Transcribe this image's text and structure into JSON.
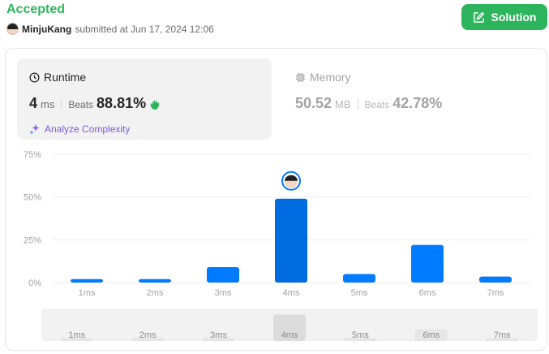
{
  "status": "Accepted",
  "submission": {
    "username": "MinjuKang",
    "submitted_text": "submitted at Jun 17, 2024 12:06"
  },
  "solution_button": {
    "label": "Solution",
    "color": "#2db55d"
  },
  "runtime": {
    "title": "Runtime",
    "value": "4",
    "unit": "ms",
    "beats_label": "Beats",
    "beats_value": "88.81%",
    "analyze_label": "Analyze Complexity"
  },
  "memory": {
    "title": "Memory",
    "value": "50.52",
    "unit": "MB",
    "beats_label": "Beats",
    "beats_value": "42.78%"
  },
  "chart_data": {
    "type": "bar",
    "categories": [
      "1ms",
      "2ms",
      "3ms",
      "4ms",
      "5ms",
      "6ms",
      "7ms"
    ],
    "values": [
      2,
      2,
      9,
      49,
      5,
      22,
      3.5
    ],
    "y_ticks": [
      "75%",
      "50%",
      "25%",
      "0%"
    ],
    "ylim": [
      0,
      75
    ],
    "highlight_category": "4ms",
    "bar_color": "#007aff",
    "highlight_color": "#006ce0",
    "grid": true
  },
  "range_strip": {
    "labels": [
      "1ms",
      "2ms",
      "3ms",
      "4ms",
      "5ms",
      "6ms",
      "7ms"
    ],
    "mini_values": [
      1,
      1,
      1,
      49,
      1,
      22,
      1
    ]
  }
}
